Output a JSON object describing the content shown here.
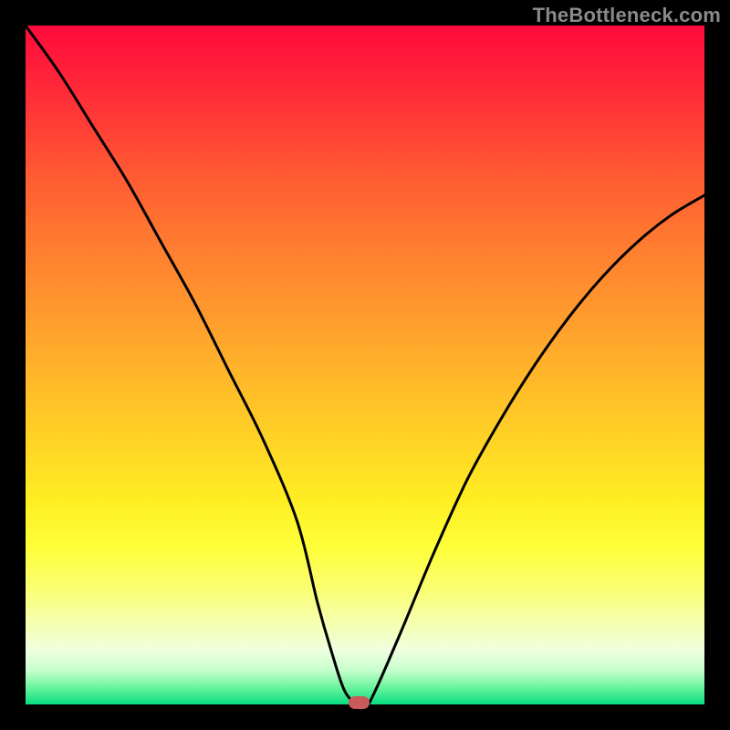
{
  "watermark": "TheBottleneck.com",
  "chart_data": {
    "type": "line",
    "title": "",
    "xlabel": "",
    "ylabel": "",
    "xlim": [
      0,
      100
    ],
    "ylim": [
      0,
      100
    ],
    "grid": false,
    "series": [
      {
        "name": "bottleneck-curve",
        "x": [
          0,
          5,
          10,
          15,
          20,
          25,
          30,
          35,
          40,
          43,
          45,
          47,
          49,
          50.5,
          55,
          60,
          65,
          70,
          75,
          80,
          85,
          90,
          95,
          100
        ],
        "y": [
          100,
          93,
          85,
          77,
          68,
          59,
          49,
          39,
          27,
          15,
          8,
          2,
          0,
          0,
          10,
          22,
          33,
          42,
          50,
          57,
          63,
          68,
          72,
          75
        ]
      }
    ],
    "marker": {
      "x": 49,
      "y": 0,
      "color": "#c85a5a"
    },
    "background_gradient": {
      "top": "#ff0a3a",
      "middle": "#ffee23",
      "bottom": "#0ade82"
    }
  }
}
